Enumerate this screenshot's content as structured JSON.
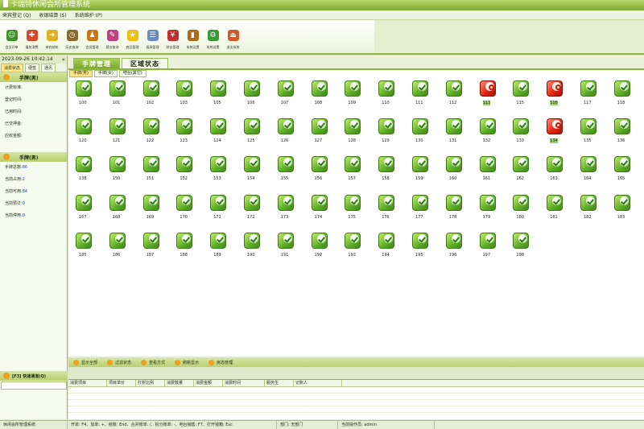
{
  "window": {
    "title": "卡瑞特休闲会所管理系统"
  },
  "menu": [
    "来宾登记 (Q)",
    "收银结算 (S)",
    "系统维护 (P)"
  ],
  "toolbar": [
    {
      "label": "会员开单",
      "icon": "user-icon",
      "color": "#3f8f2a"
    },
    {
      "label": "填加消费",
      "icon": "add-consumption-icon",
      "color": "#d44a2a"
    },
    {
      "label": "来宾结帐",
      "icon": "checkout-arrow-icon",
      "color": "#e0b020"
    },
    {
      "label": "历史查询",
      "icon": "clock-icon",
      "color": "#8a6a2a"
    },
    {
      "label": "会员管理",
      "icon": "members-icon",
      "color": "#c47a1a"
    },
    {
      "label": "营业查询",
      "icon": "sales-query-icon",
      "color": "#c04080"
    },
    {
      "label": "商品管理",
      "icon": "star-icon",
      "color": "#f0c010"
    },
    {
      "label": "报表管理",
      "icon": "report-icon",
      "color": "#6a8ac0"
    },
    {
      "label": "财务管理",
      "icon": "finance-icon",
      "color": "#c03030"
    },
    {
      "label": "系统设置",
      "icon": "door-icon",
      "color": "#b06a1a"
    },
    {
      "label": "系统设置",
      "icon": "settings-gear-icon",
      "color": "#3a9a3a"
    },
    {
      "label": "退出系统",
      "icon": "exit-icon",
      "color": "#d05a2a"
    }
  ],
  "left": {
    "datetime": "2023-09-26 10:42:14",
    "collapse": "«",
    "tabs": [
      "消费状态",
      "便签",
      "通讯"
    ],
    "section1": {
      "title": "手牌(男)",
      "rows": [
        {
          "label": "计费标准:",
          "value": ""
        },
        {
          "label": "登记时间:",
          "value": ""
        },
        {
          "label": "已用时间:",
          "value": ""
        },
        {
          "label": "已交押金:",
          "value": ""
        },
        {
          "label": "应收金额:",
          "value": ""
        }
      ]
    },
    "section2": {
      "title": "手牌(男)",
      "rows": [
        {
          "label": "手牌总数:",
          "value": "86"
        },
        {
          "label": "当前占用:",
          "value": "2"
        },
        {
          "label": "当前可用:",
          "value": "84"
        },
        {
          "label": "当前预订:",
          "value": "0"
        },
        {
          "label": "当前停用:",
          "value": "0"
        }
      ]
    },
    "quick": {
      "title": "[F3] 快速通道(Q)"
    }
  },
  "main": {
    "tabs": [
      "手牌管理",
      "区域状态"
    ],
    "subtabs": [
      "手牌(男)",
      "手牌(女)",
      "吧台(其它)"
    ],
    "rows": [
      [
        "100",
        "101",
        "102",
        "103",
        "105",
        "106",
        "107",
        "108",
        "109",
        "110",
        "111",
        "112",
        "113",
        "115",
        "116",
        "117",
        "118"
      ],
      [
        "120",
        "121",
        "122",
        "123",
        "124",
        "125",
        "126",
        "127",
        "128",
        "129",
        "130",
        "131",
        "132",
        "133",
        "134",
        "135",
        "136"
      ],
      [
        "138",
        "150",
        "151",
        "152",
        "153",
        "154",
        "155",
        "156",
        "157",
        "158",
        "159",
        "160",
        "161",
        "162",
        "163",
        "164",
        "165"
      ],
      [
        "167",
        "168",
        "169",
        "170",
        "171",
        "172",
        "173",
        "174",
        "175",
        "176",
        "177",
        "178",
        "179",
        "180",
        "181",
        "182",
        "183"
      ],
      [
        "185",
        "186",
        "187",
        "188",
        "189",
        "190",
        "191",
        "192",
        "193",
        "194",
        "195",
        "196",
        "197",
        "198"
      ]
    ],
    "busy": [
      "113",
      "116",
      "134"
    ]
  },
  "actions": [
    "显示全部",
    "过滤状态",
    "查看方式",
    "刷新显示",
    "房态管理"
  ],
  "table": {
    "headers": [
      "消费项目",
      "项目单价",
      "打折比例",
      "消费数量",
      "消费金额",
      "消费时间",
      "服务生",
      "记账人"
    ],
    "widths": [
      48,
      36,
      36,
      36,
      36,
      52,
      36,
      60
    ]
  },
  "status": {
    "app": "休闲会所管理系统",
    "shortcuts": "开单: F4、加单: +、结账: End、合并账单: /、拆分账单: -、吧台销售: F7、打开钱箱: Esc",
    "dept": "部门: 无部门",
    "operator": "当前操作员: admin"
  }
}
